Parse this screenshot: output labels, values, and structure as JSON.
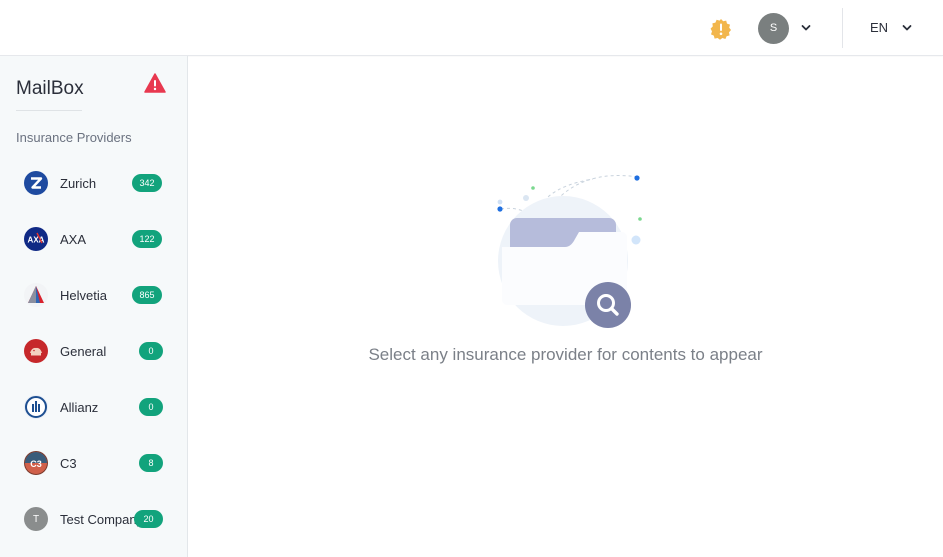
{
  "topbar": {
    "notification_icon": "alert-badge-icon",
    "user_initial": "S",
    "language": "EN",
    "colors": {
      "alert": "#f2b64c",
      "avatar": "#7a7f7f"
    }
  },
  "sidebar": {
    "title": "MailBox",
    "warning_icon": "warning-triangle-icon",
    "section_label": "Insurance Providers",
    "providers": [
      {
        "name": "Zurich",
        "count": "342",
        "logo": "zurich-logo"
      },
      {
        "name": "AXA",
        "count": "122",
        "logo": "axa-logo"
      },
      {
        "name": "Helvetia",
        "count": "865",
        "logo": "helvetia-logo"
      },
      {
        "name": "General",
        "count": "0",
        "logo": "generali-logo"
      },
      {
        "name": "Allianz",
        "count": "0",
        "logo": "allianz-logo"
      },
      {
        "name": "C3",
        "count": "8",
        "logo": "c3-logo"
      },
      {
        "name": "Test Company",
        "count": "20",
        "logo": "initial-avatar",
        "initial": "T"
      }
    ],
    "colors": {
      "badge": "#12a37c",
      "warning": "#e8384f"
    }
  },
  "main": {
    "empty_message": "Select any insurance provider for contents to appear",
    "illustration": "empty-folder-search-illustration"
  }
}
